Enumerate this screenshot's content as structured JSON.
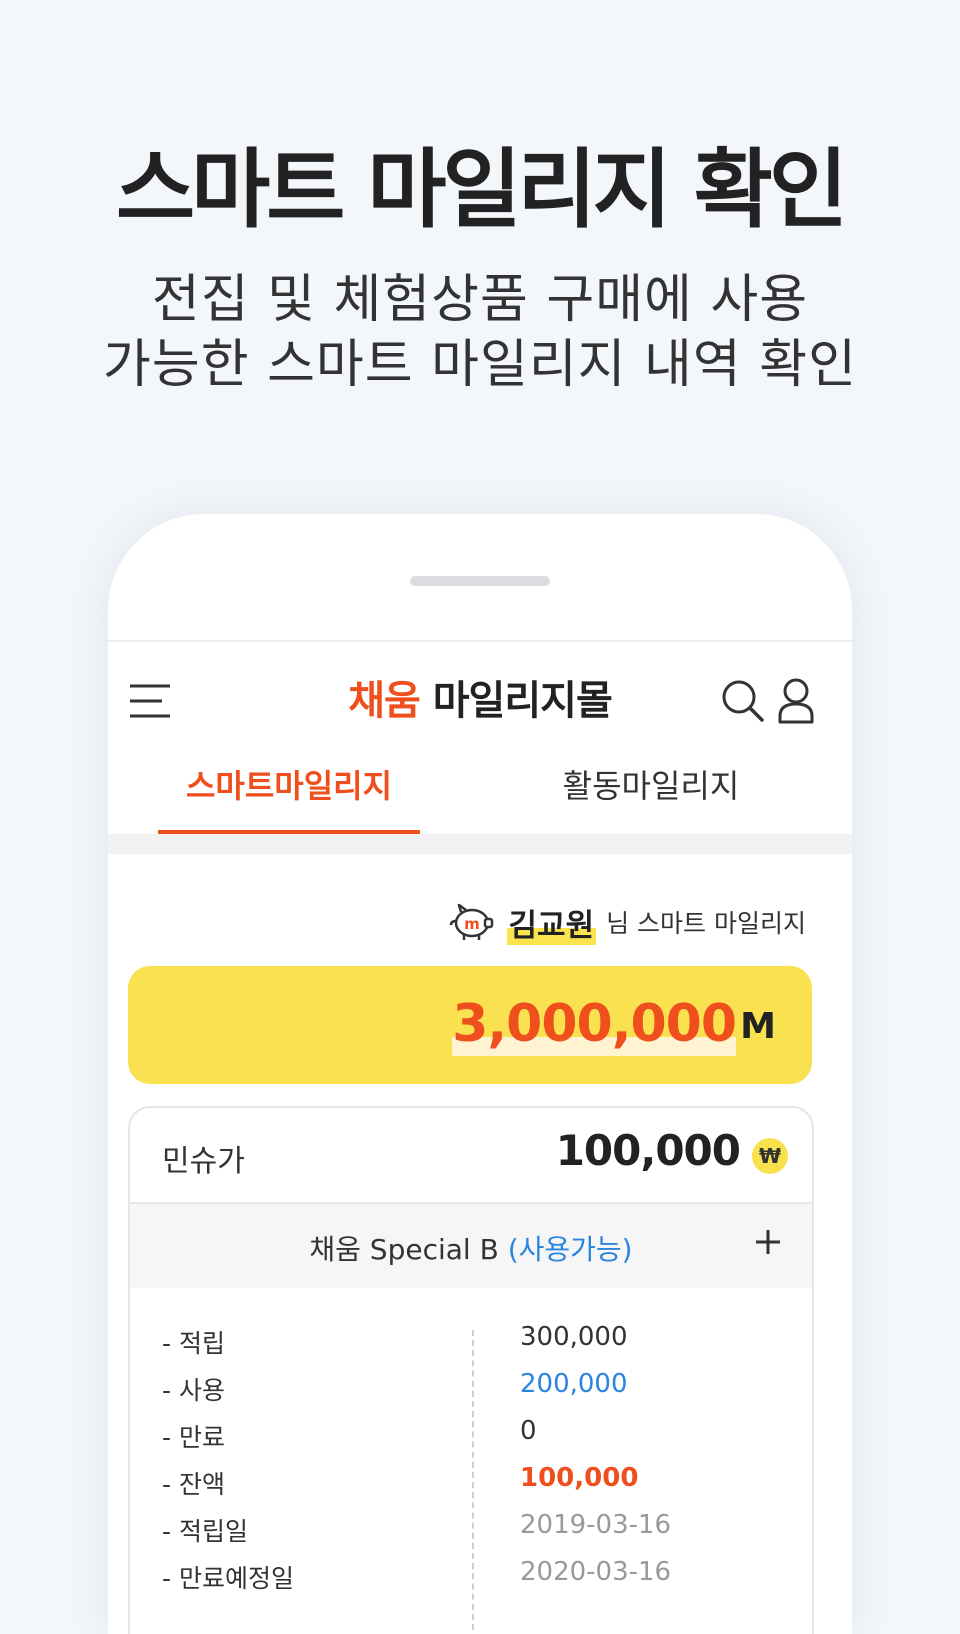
{
  "hero": {
    "title": "스마트 마일리지 확인",
    "subtitle_line1": "전집 및 체험상품 구매에 사용",
    "subtitle_line2": "가능한 스마트 마일리지 내역 확인"
  },
  "app": {
    "brand": "채움",
    "title_rest": " 마일리지몰",
    "icons": [
      "menu-icon",
      "search-icon",
      "user-icon"
    ]
  },
  "tabs": [
    {
      "label": "스마트마일리지",
      "active": true
    },
    {
      "label": "활동마일리지",
      "active": false
    }
  ],
  "owner": {
    "name": "김교원",
    "suffix": "님 스마트 마일리지"
  },
  "balance": {
    "value": "3,000,000",
    "unit": "M"
  },
  "product": {
    "name": "민슈가",
    "price": "100,000",
    "currency_symbol": "₩",
    "plan_name": "채움 Special B",
    "plan_status": "(사용가능)"
  },
  "details": [
    {
      "label": "- 적립",
      "value": "300,000",
      "style": "normal"
    },
    {
      "label": "- 사용",
      "value": "200,000",
      "style": "blue"
    },
    {
      "label": "- 만료",
      "value": "0",
      "style": "normal"
    },
    {
      "label": "- 잔액",
      "value": "100,000",
      "style": "red"
    },
    {
      "label": "- 적립일",
      "value": "2019-03-16",
      "style": "gray"
    },
    {
      "label": "- 만료예정일",
      "value": "2020-03-16",
      "style": "gray"
    }
  ],
  "colors": {
    "accent": "#ef4e1d",
    "highlight": "#f9e150",
    "link_blue": "#2b85df",
    "background": "#f3f6fa"
  }
}
